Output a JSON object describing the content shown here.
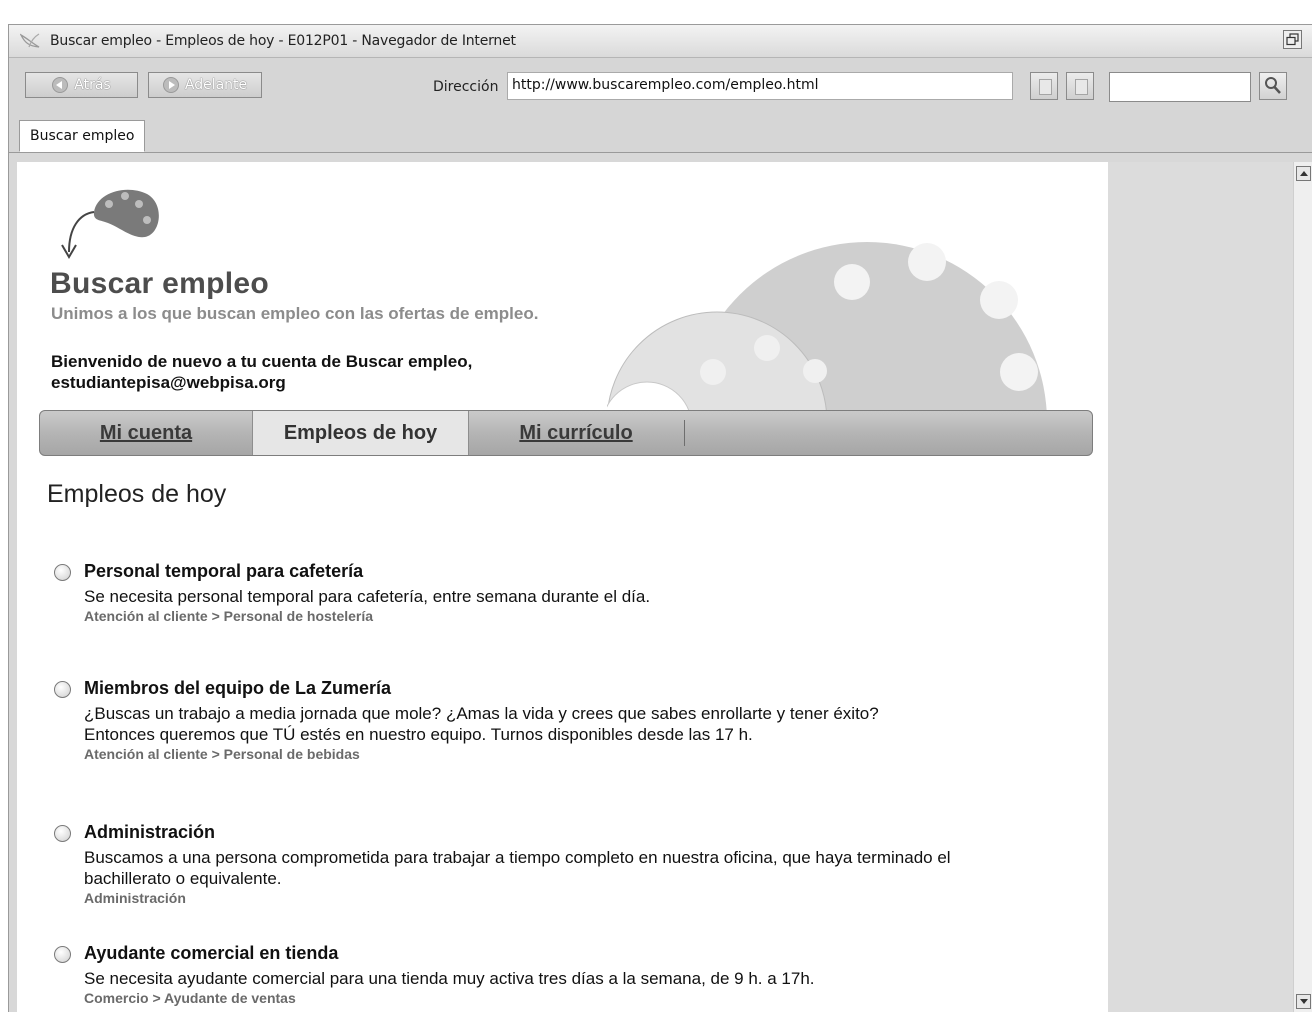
{
  "window": {
    "title": "Buscar empleo - Empleos de hoy - E012P01 - Navegador de Internet"
  },
  "toolbar": {
    "back_label": "Atrás",
    "forward_label": "Adelante",
    "address_label": "Dirección",
    "address_value": "http://www.buscarempleo.com/empleo.html",
    "search_value": ""
  },
  "tabs": {
    "current": "Buscar empleo"
  },
  "site": {
    "title": "Buscar empleo",
    "tagline": "Unimos a los que buscan empleo con las ofertas de empleo.",
    "welcome_line1": "Bienvenido de nuevo a tu cuenta de Buscar empleo,",
    "welcome_line2": "estudiantepisa@webpisa.org"
  },
  "nav": {
    "items": [
      {
        "label": "Mi cuenta",
        "active": false
      },
      {
        "label": "Empleos de hoy",
        "active": true
      },
      {
        "label": "Mi currículo",
        "active": false
      }
    ]
  },
  "main": {
    "heading": "Empleos de hoy",
    "jobs": [
      {
        "title": "Personal temporal para cafetería",
        "desc_lines": [
          "Se necesita personal temporal para cafetería, entre semana durante el día."
        ],
        "category": "Atención al cliente > Personal de hostelería"
      },
      {
        "title": "Miembros del equipo de La Zumería",
        "desc_lines": [
          "¿Buscas un trabajo a media jornada que mole? ¿Amas la vida y crees que sabes enrollarte y tener éxito?",
          "Entonces queremos que TÚ estés en nuestro equipo. Turnos disponibles desde las 17 h."
        ],
        "category": "Atención al cliente > Personal de bebidas"
      },
      {
        "title": "Administración",
        "desc_lines": [
          "Buscamos a una persona comprometida para trabajar a tiempo completo en nuestra oficina, que haya terminado el",
          "bachillerato o equivalente."
        ],
        "category": "Administración"
      },
      {
        "title": "Ayudante comercial en tienda",
        "desc_lines": [
          "Se necesita ayudante comercial para una tienda muy activa tres días a la semana, de 9 h. a 17h."
        ],
        "category": "Comercio > Ayudante de ventas"
      }
    ]
  }
}
